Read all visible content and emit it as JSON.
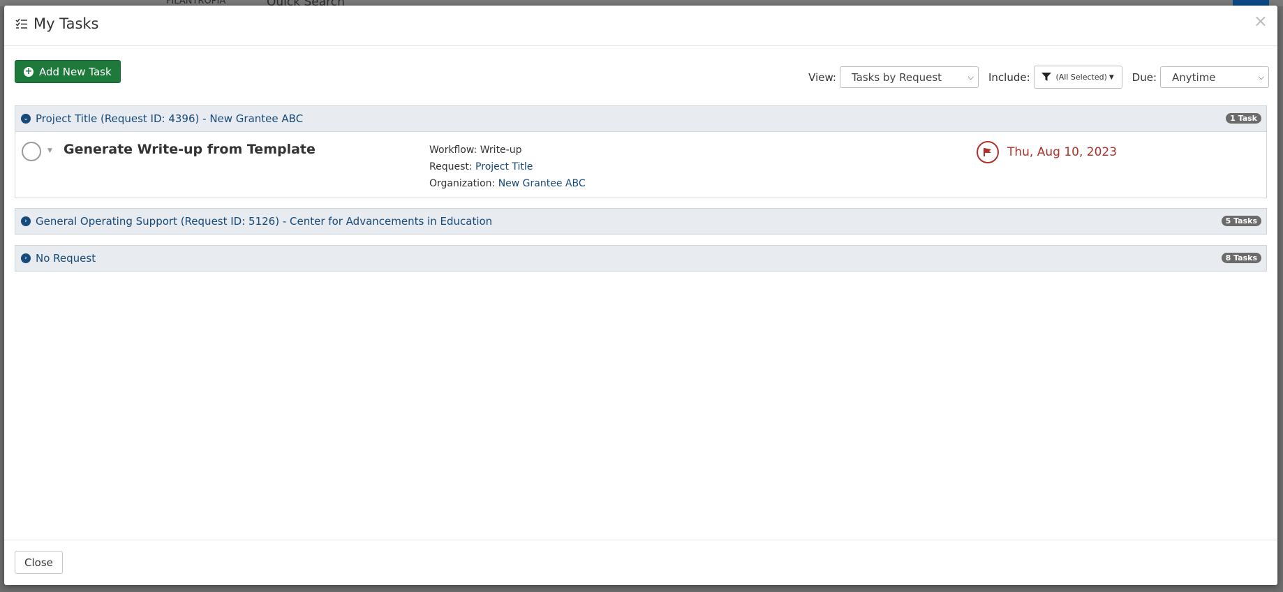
{
  "background": {
    "logo_text": "FILANTROPIA",
    "search_text": "Quick Search"
  },
  "modal": {
    "title": "My Tasks",
    "close_symbol": "×",
    "close_button_label": "Close"
  },
  "toolbar": {
    "add_task_label": "Add New Task",
    "view_label": "View:",
    "view_value": "Tasks by Request",
    "include_label": "Include:",
    "include_value": "(All Selected)",
    "due_label": "Due:",
    "due_value": "Anytime"
  },
  "groups": [
    {
      "title": "Project Title (Request ID: 4396) - New Grantee ABC",
      "badge": "1 Task",
      "expanded": true,
      "tasks": [
        {
          "title": "Generate Write-up from Template",
          "workflow_label": "Workflow:",
          "workflow_value": "Write-up",
          "request_label": "Request:",
          "request_value": "Project Title",
          "organization_label": "Organization:",
          "organization_value": "New Grantee ABC",
          "due_date": "Thu, Aug 10, 2023"
        }
      ]
    },
    {
      "title": "General Operating Support (Request ID: 5126) - Center for Advancements in Education",
      "badge": "5 Tasks",
      "expanded": false
    },
    {
      "title": "No Request",
      "badge": "8 Tasks",
      "expanded": false
    }
  ],
  "colors": {
    "primary_green": "#1e7a3a",
    "link_blue": "#164a7a",
    "overdue_red": "#b2302b",
    "group_header_bg": "#e8ebef"
  },
  "icons": {
    "title_icon": "task-list-icon",
    "filter_icon": "funnel-icon",
    "due_icon": "flag-icon"
  }
}
